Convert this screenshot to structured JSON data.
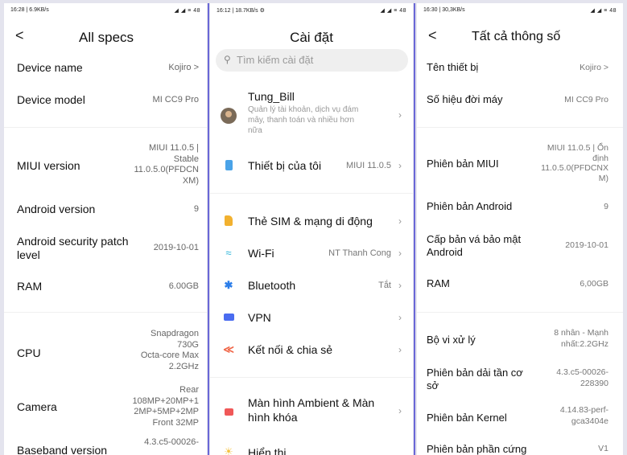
{
  "panel1": {
    "status_left": "16:28 | 6.9KB/s",
    "status_right": "◢ ◢ ≡ 48",
    "back": "<",
    "title": "All specs",
    "rows": [
      {
        "label": "Device name",
        "value": "Kojiro >"
      },
      {
        "label": "Device model",
        "value": "MI CC9 Pro"
      },
      {
        "label": "MIUI version",
        "value": "MIUI 11.0.5 |\nStable\n11.0.5.0(PFDCN\nXM)"
      },
      {
        "label": "Android version",
        "value": "9"
      },
      {
        "label": "Android security patch\nlevel",
        "value": "2019-10-01"
      },
      {
        "label": "RAM",
        "value": "6.00GB"
      },
      {
        "label": "CPU",
        "value": "Snapdragon\n730G\nOcta-core Max\n2.2GHz"
      },
      {
        "label": "Camera",
        "value": "Rear\n108MP+20MP+1\n2MP+5MP+2MP\nFront 32MP"
      },
      {
        "label": "Baseband version",
        "value": "4.3.c5-00026-"
      }
    ]
  },
  "panel2": {
    "status_left": "16:12 | 18.7KB/s ⚙",
    "status_right": "◢ ◢ ≡ 48",
    "title": "Cài đặt",
    "search_placeholder": "Tìm kiếm cài đặt",
    "account": {
      "name": "Tung_Bill",
      "subtitle": "Quản lý tài khoản, dịch vụ đám\nmây, thanh toán và nhiều hơn\nnữa"
    },
    "items": [
      {
        "label": "Thiết bị của tôi",
        "value": "MIUI 11.0.5",
        "icon": "phone-icon"
      },
      {
        "label": "Thẻ SIM & mạng di động",
        "value": "",
        "icon": "sim-icon"
      },
      {
        "label": "Wi-Fi",
        "value": "NT Thanh Cong",
        "icon": "wifi-icon"
      },
      {
        "label": "Bluetooth",
        "value": "Tắt",
        "icon": "bluetooth-icon"
      },
      {
        "label": "VPN",
        "value": "",
        "icon": "vpn-icon"
      },
      {
        "label": "Kết nối & chia sẻ",
        "value": "",
        "icon": "share-icon"
      },
      {
        "label": "Màn hình Ambient & Màn\nhình khóa",
        "value": "",
        "icon": "lock-icon"
      },
      {
        "label": "Hiển thị",
        "value": "",
        "icon": "display-icon"
      }
    ],
    "colors": {
      "phone": "#4aa3e8",
      "sim": "#f2b12f",
      "wifi": "#2bb4d9",
      "bluetooth": "#2b7de9",
      "vpn": "#4a6cf0",
      "share": "#f0684a",
      "lock": "#f05858",
      "display": "#f5c342"
    }
  },
  "panel3": {
    "status_left": "16:30 | 30,3KB/s",
    "status_right": "◢ ◢ ≡ 48",
    "back": "<",
    "title": "Tất cả thông số",
    "rows": [
      {
        "label": "Tên thiết bị",
        "value": "Kojiro >"
      },
      {
        "label": "Số hiệu đời máy",
        "value": "MI CC9 Pro"
      },
      {
        "label": "Phiên bản MIUI",
        "value": "MIUI 11.0.5 | Ổn\nđịnh\n11.0.5.0(PFDCNX\nM)"
      },
      {
        "label": "Phiên bản Android",
        "value": "9"
      },
      {
        "label": "Cấp bản vá bảo mật\nAndroid",
        "value": "2019-10-01"
      },
      {
        "label": "RAM",
        "value": "6,00GB"
      },
      {
        "label": "Bộ vi xử lý",
        "value": "8 nhân - Mạnh\nnhất:2.2GHz"
      },
      {
        "label": "Phiên bản dải tần cơ\nsở",
        "value": "4.3.c5-00026-\n228390"
      },
      {
        "label": "Phiên bản Kernel",
        "value": "4.14.83-perf-\ngca3404e"
      },
      {
        "label": "Phiên bản phần cứng",
        "value": "V1"
      }
    ]
  }
}
